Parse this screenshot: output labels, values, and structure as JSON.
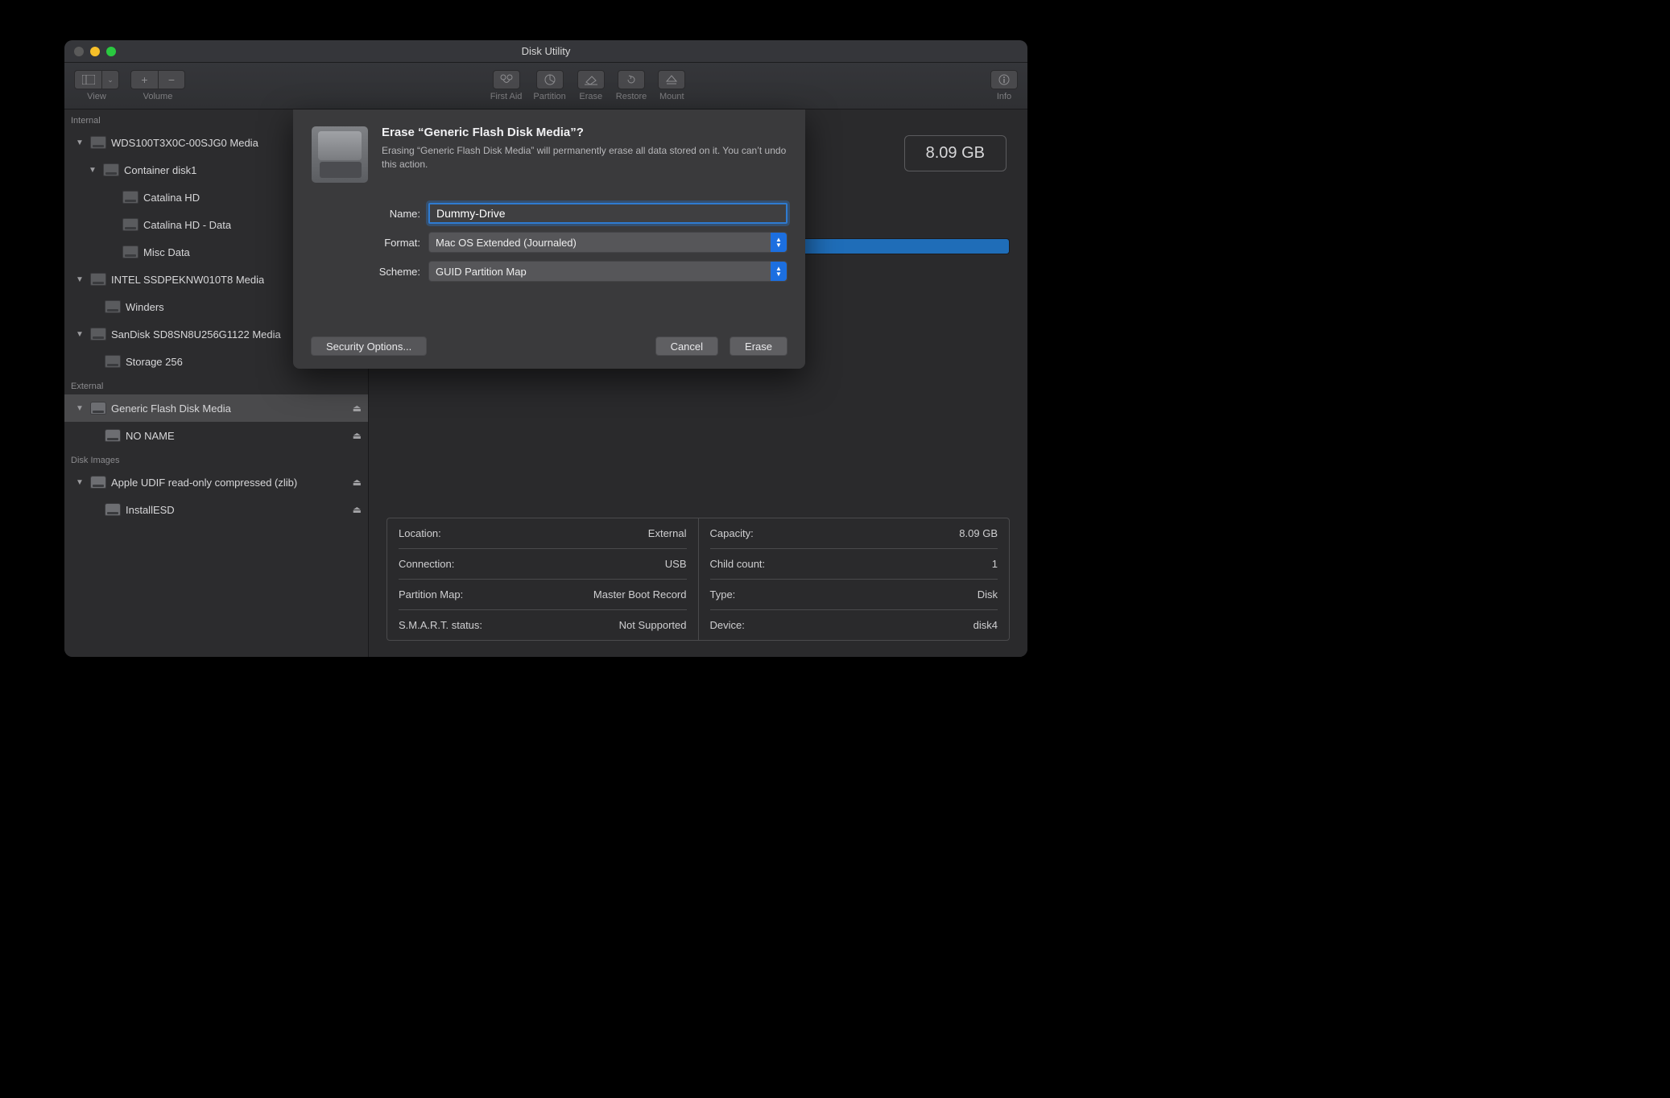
{
  "window": {
    "title": "Disk Utility"
  },
  "toolbar": {
    "view_label": "View",
    "volume_label": "Volume",
    "firstaid_label": "First Aid",
    "partition_label": "Partition",
    "erase_label": "Erase",
    "restore_label": "Restore",
    "mount_label": "Mount",
    "info_label": "Info"
  },
  "sidebar": {
    "sections": {
      "internal_label": "Internal",
      "external_label": "External",
      "diskimages_label": "Disk Images"
    },
    "internal": [
      {
        "label": "WDS100T3X0C-00SJG0 Media"
      },
      {
        "label": "Container disk1"
      },
      {
        "label": "Catalina HD"
      },
      {
        "label": "Catalina HD - Data"
      },
      {
        "label": "Misc Data"
      },
      {
        "label": "INTEL SSDPEKNW010T8 Media"
      },
      {
        "label": "Winders"
      },
      {
        "label": "SanDisk SD8SN8U256G1122 Media"
      },
      {
        "label": "Storage 256"
      }
    ],
    "external": [
      {
        "label": "Generic Flash Disk Media"
      },
      {
        "label": "NO NAME"
      }
    ],
    "diskimages": [
      {
        "label": "Apple UDIF read-only compressed (zlib)"
      },
      {
        "label": "InstallESD"
      }
    ]
  },
  "main": {
    "capacity": "8.09 GB",
    "details_left": [
      {
        "k": "Location:",
        "v": "External"
      },
      {
        "k": "Connection:",
        "v": "USB"
      },
      {
        "k": "Partition Map:",
        "v": "Master Boot Record"
      },
      {
        "k": "S.M.A.R.T. status:",
        "v": "Not Supported"
      }
    ],
    "details_right": [
      {
        "k": "Capacity:",
        "v": "8.09 GB"
      },
      {
        "k": "Child count:",
        "v": "1"
      },
      {
        "k": "Type:",
        "v": "Disk"
      },
      {
        "k": "Device:",
        "v": "disk4"
      }
    ]
  },
  "modal": {
    "title": "Erase “Generic Flash Disk Media”?",
    "subtitle": "Erasing “Generic Flash Disk Media” will permanently erase all data stored on it. You can’t undo this action.",
    "name_label": "Name:",
    "name_value": "Dummy-Drive",
    "format_label": "Format:",
    "format_value": "Mac OS Extended (Journaled)",
    "scheme_label": "Scheme:",
    "scheme_value": "GUID Partition Map",
    "security_label": "Security Options...",
    "cancel_label": "Cancel",
    "erase_label": "Erase"
  }
}
